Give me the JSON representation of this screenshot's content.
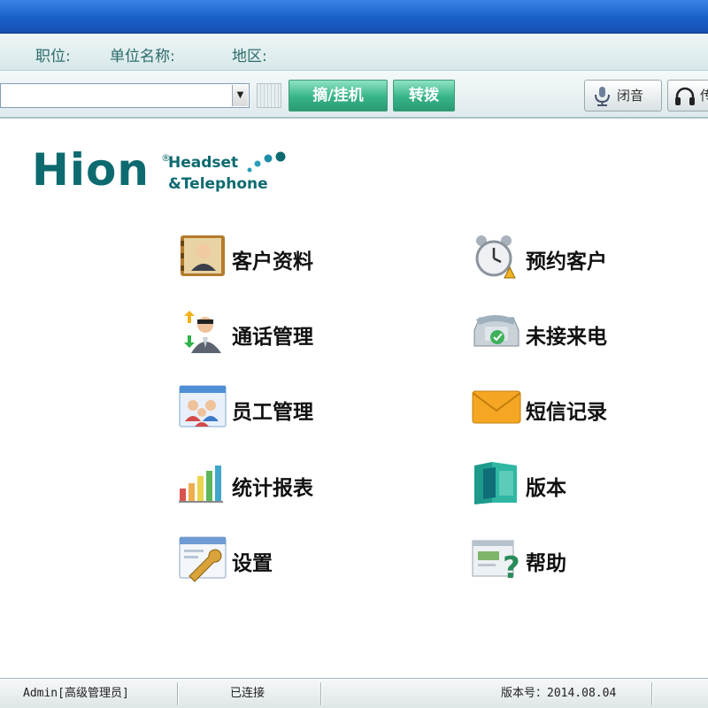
{
  "infobar": {
    "position_label": "职位:",
    "company_label": "单位名称:",
    "region_label": "地区:"
  },
  "toolbar": {
    "combo_value": "",
    "pickup_hangup_label": "摘/挂机",
    "transfer_label": "转拨",
    "mute_label": "闭音",
    "headset_label": "传"
  },
  "logo": {
    "word": "Hion",
    "reg": "®",
    "line1": "Headset",
    "line2": "&Telephone"
  },
  "menu": {
    "customer_info": "客户资料",
    "scheduled_customers": "预约客户",
    "call_management": "通话管理",
    "missed_calls": "未接来电",
    "staff_management": "员工管理",
    "sms_records": "短信记录",
    "statistics_reports": "统计报表",
    "version": "版本",
    "settings": "设置",
    "help": "帮助"
  },
  "status": {
    "user": "Admin[高级管理员]",
    "connection": "已连接",
    "version": "版本号：2014.08.04"
  },
  "colors": {
    "title_blue": "#1a5fc8",
    "brand_teal": "#0d6b70",
    "button_green": "#37b488"
  }
}
